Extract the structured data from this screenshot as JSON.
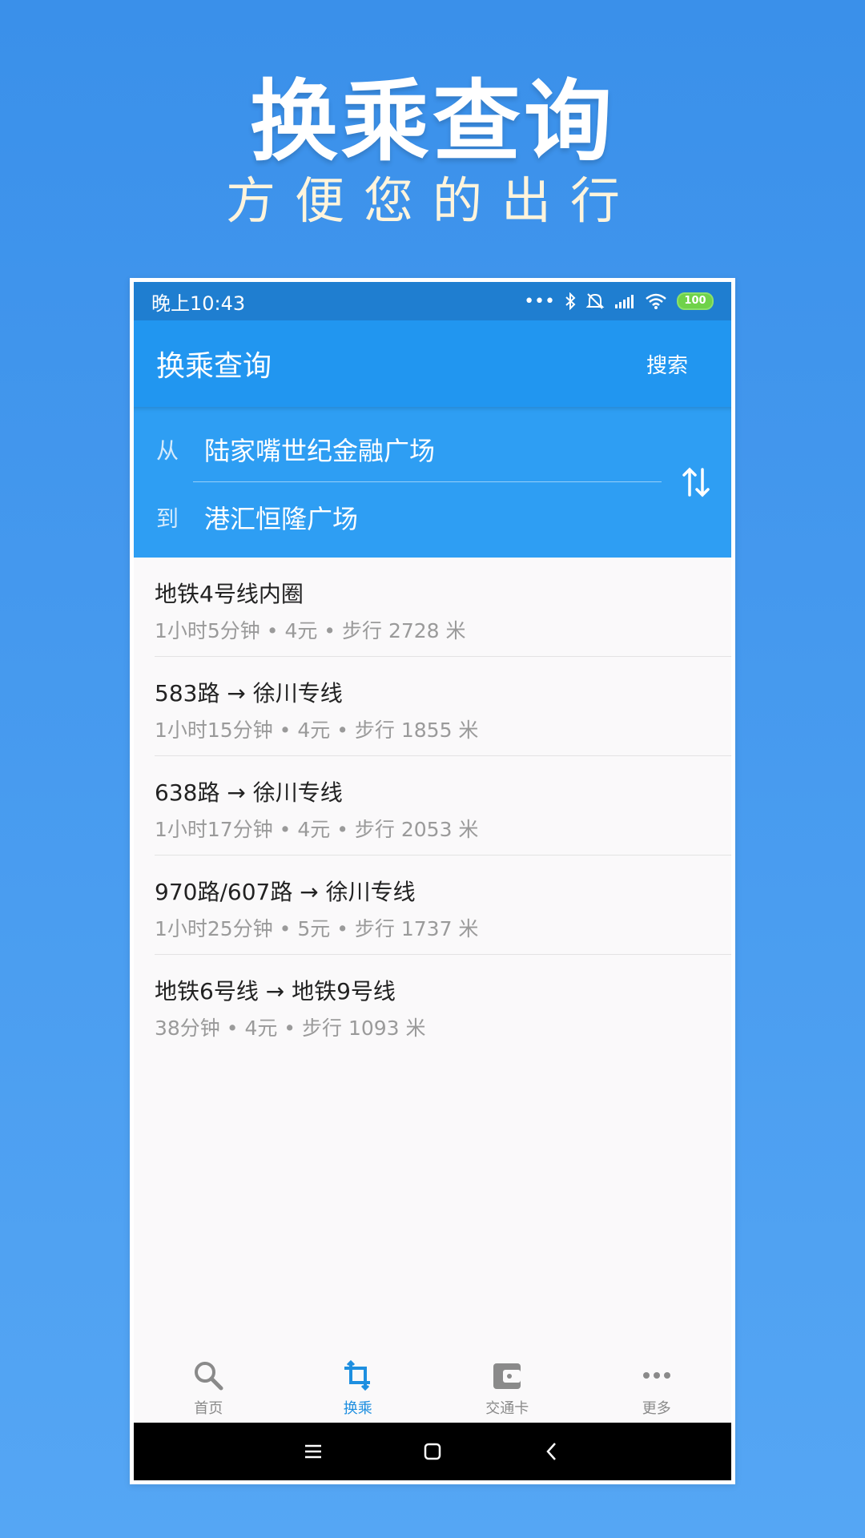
{
  "promo": {
    "title": "换乘查询",
    "subtitle": "方便您的出行"
  },
  "status_bar": {
    "time": "晚上10:43",
    "battery": "100"
  },
  "app_bar": {
    "title": "换乘查询",
    "search_label": "搜索"
  },
  "route": {
    "from_label": "从",
    "from_value": "陆家嘴世纪金融广场",
    "to_label": "到",
    "to_value": "港汇恒隆广场"
  },
  "results": [
    {
      "name": "地铁4号线内圈",
      "meta": "1小时5分钟 • 4元 • 步行 2728 米"
    },
    {
      "name": "583路 → 徐川专线",
      "meta": "1小时15分钟 • 4元 • 步行 1855 米"
    },
    {
      "name": "638路 → 徐川专线",
      "meta": "1小时17分钟 • 4元 • 步行 2053 米"
    },
    {
      "name": "970路/607路 → 徐川专线",
      "meta": "1小时25分钟 • 5元 • 步行 1737 米"
    },
    {
      "name": "地铁6号线 → 地铁9号线",
      "meta": "38分钟 • 4元 • 步行 1093 米"
    }
  ],
  "bottom_nav": {
    "items": [
      {
        "label": "首页",
        "icon": "search-icon",
        "active": false
      },
      {
        "label": "换乘",
        "icon": "transfer-icon",
        "active": true
      },
      {
        "label": "交通卡",
        "icon": "wallet-icon",
        "active": false
      },
      {
        "label": "更多",
        "icon": "more-icon",
        "active": false
      }
    ]
  },
  "colors": {
    "accent": "#2196f0",
    "active_tab": "#1e8fe0",
    "status_bar": "#1f7ed0"
  }
}
